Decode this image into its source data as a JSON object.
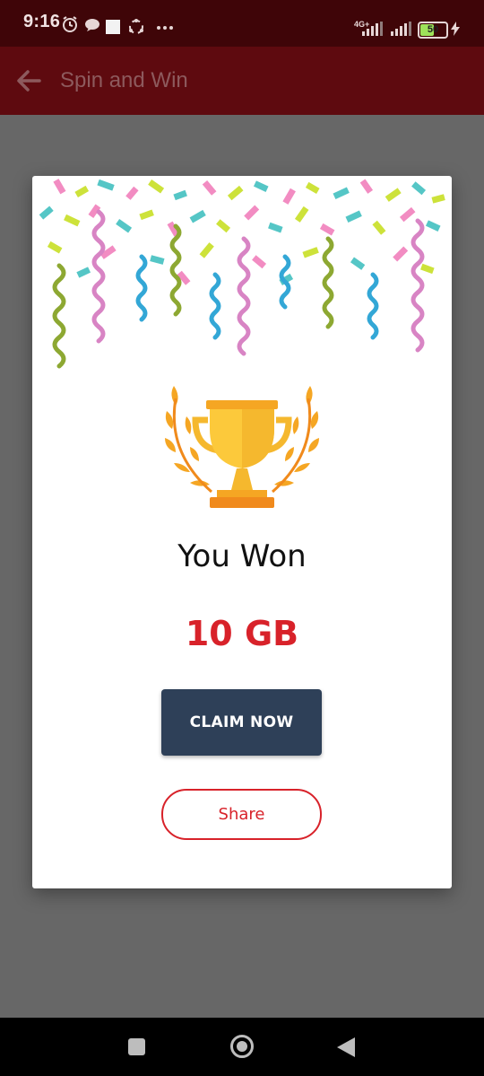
{
  "status_bar": {
    "time": "9:16",
    "network": "4G+",
    "battery": "50"
  },
  "app_bar": {
    "title": "Spin and Win",
    "back_icon": "arrow-left-icon"
  },
  "dialog": {
    "title": "You Won",
    "prize": "10 GB",
    "claim_label": "CLAIM NOW",
    "share_label": "Share",
    "trophy_icon": "trophy-icon",
    "colors": {
      "prize": "#d8222a",
      "claim_bg": "#2e4058",
      "share_border": "#d8222a"
    }
  },
  "nav_bar": {
    "recents_icon": "square-icon",
    "home_icon": "circle-icon",
    "back_icon": "triangle-back-icon"
  }
}
